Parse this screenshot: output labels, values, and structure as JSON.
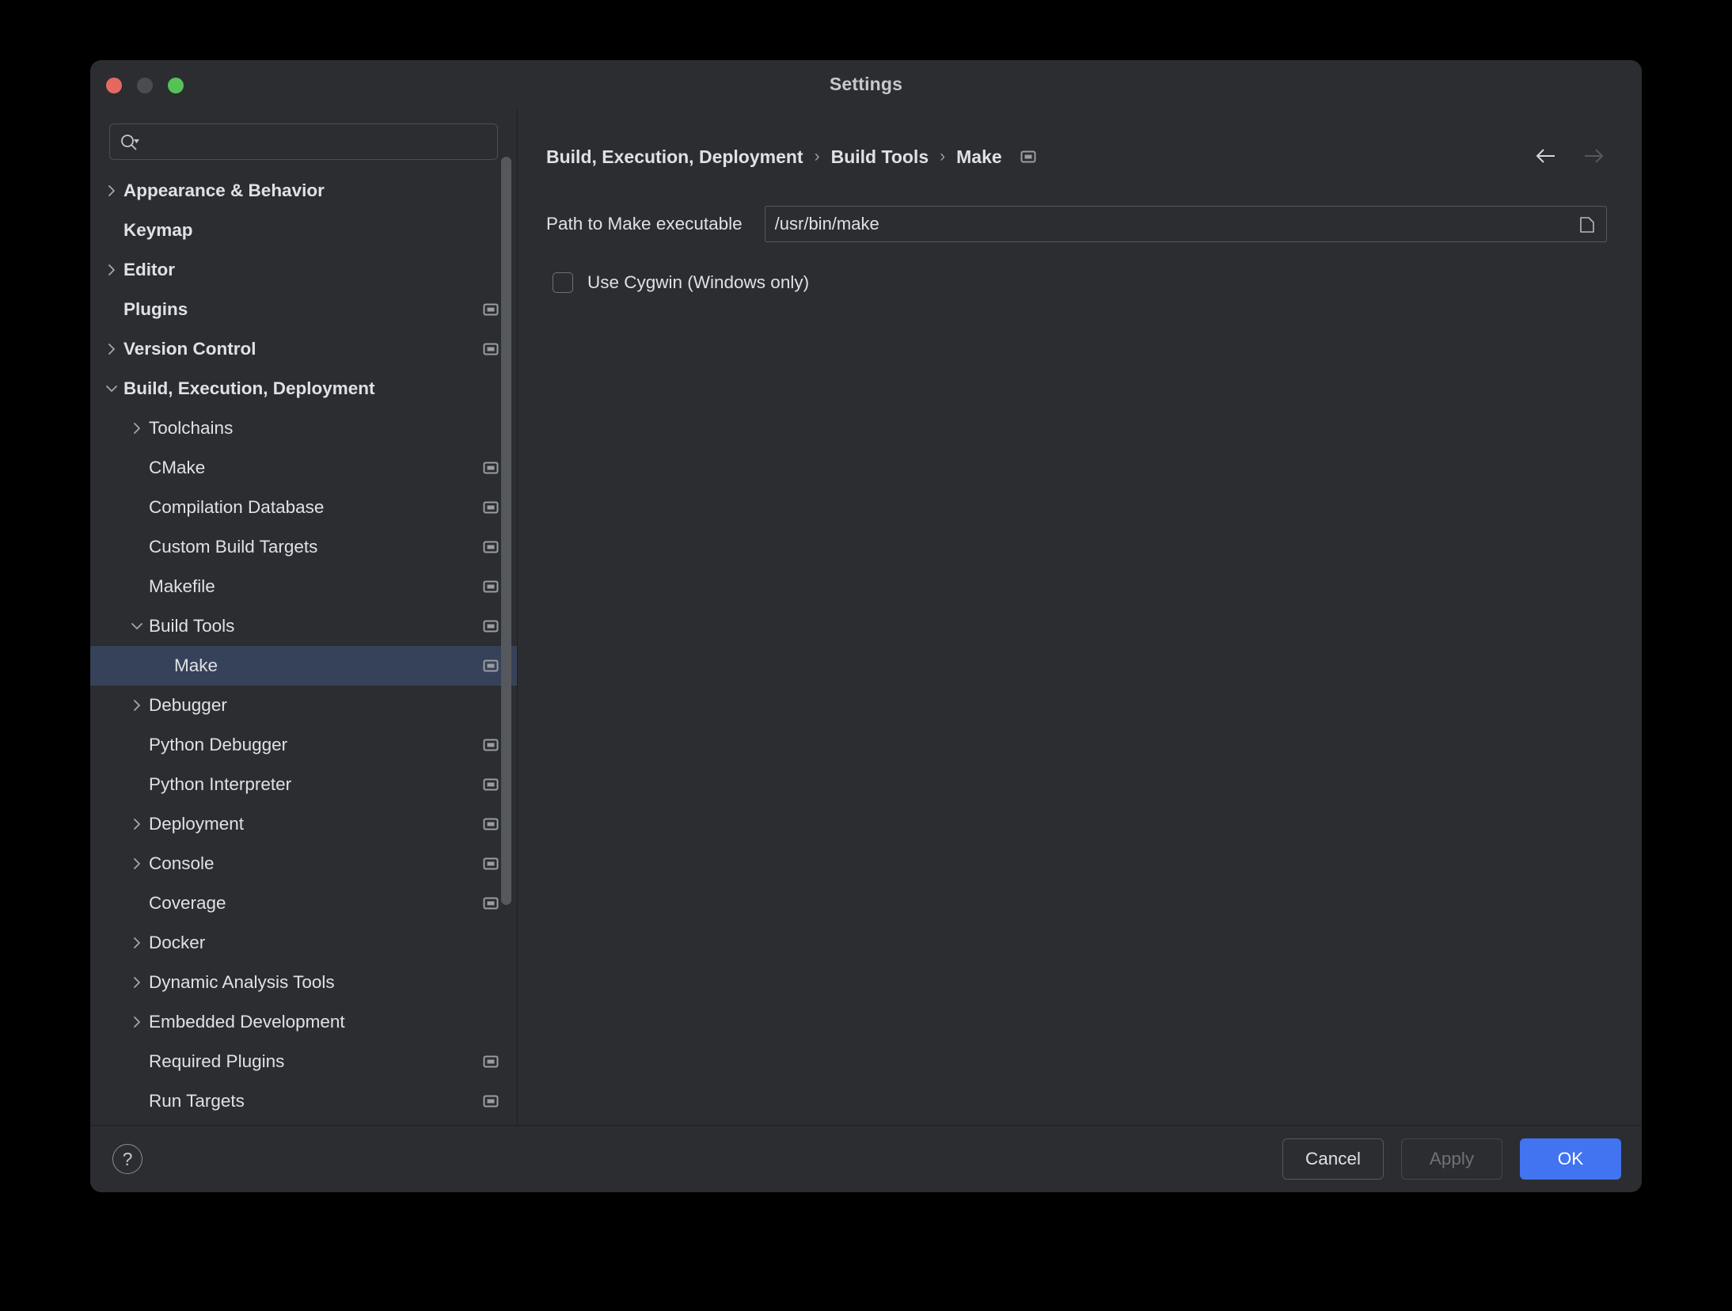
{
  "window": {
    "title": "Settings",
    "traffic_lights": [
      "close-red",
      "minimize-amber",
      "zoom-green"
    ],
    "accent_color": "#4274f1",
    "selection_color": "#364259",
    "background_color": "#2b2d30"
  },
  "search": {
    "value": "",
    "placeholder": "",
    "icon": "search-icon"
  },
  "sidebar": {
    "items": [
      {
        "label": "Appearance & Behavior",
        "level": 0,
        "chevron": "right",
        "badge": false,
        "selected": false
      },
      {
        "label": "Keymap",
        "level": 0,
        "chevron": "none",
        "badge": false,
        "selected": false
      },
      {
        "label": "Editor",
        "level": 0,
        "chevron": "right",
        "badge": false,
        "selected": false
      },
      {
        "label": "Plugins",
        "level": 0,
        "chevron": "none",
        "badge": true,
        "selected": false
      },
      {
        "label": "Version Control",
        "level": 0,
        "chevron": "right",
        "badge": true,
        "selected": false
      },
      {
        "label": "Build, Execution, Deployment",
        "level": 0,
        "chevron": "down",
        "badge": false,
        "selected": false
      },
      {
        "label": "Toolchains",
        "level": 1,
        "chevron": "right",
        "badge": false,
        "selected": false
      },
      {
        "label": "CMake",
        "level": 1,
        "chevron": "none",
        "badge": true,
        "selected": false
      },
      {
        "label": "Compilation Database",
        "level": 1,
        "chevron": "none",
        "badge": true,
        "selected": false
      },
      {
        "label": "Custom Build Targets",
        "level": 1,
        "chevron": "none",
        "badge": true,
        "selected": false
      },
      {
        "label": "Makefile",
        "level": 1,
        "chevron": "none",
        "badge": true,
        "selected": false
      },
      {
        "label": "Build Tools",
        "level": 1,
        "chevron": "down",
        "badge": true,
        "selected": false
      },
      {
        "label": "Make",
        "level": 2,
        "chevron": "none",
        "badge": true,
        "selected": true
      },
      {
        "label": "Debugger",
        "level": 1,
        "chevron": "right",
        "badge": false,
        "selected": false
      },
      {
        "label": "Python Debugger",
        "level": 1,
        "chevron": "none",
        "badge": true,
        "selected": false
      },
      {
        "label": "Python Interpreter",
        "level": 1,
        "chevron": "none",
        "badge": true,
        "selected": false
      },
      {
        "label": "Deployment",
        "level": 1,
        "chevron": "right",
        "badge": true,
        "selected": false
      },
      {
        "label": "Console",
        "level": 1,
        "chevron": "right",
        "badge": true,
        "selected": false
      },
      {
        "label": "Coverage",
        "level": 1,
        "chevron": "none",
        "badge": true,
        "selected": false
      },
      {
        "label": "Docker",
        "level": 1,
        "chevron": "right",
        "badge": false,
        "selected": false
      },
      {
        "label": "Dynamic Analysis Tools",
        "level": 1,
        "chevron": "right",
        "badge": false,
        "selected": false
      },
      {
        "label": "Embedded Development",
        "level": 1,
        "chevron": "right",
        "badge": false,
        "selected": false
      },
      {
        "label": "Required Plugins",
        "level": 1,
        "chevron": "none",
        "badge": true,
        "selected": false
      },
      {
        "label": "Run Targets",
        "level": 1,
        "chevron": "none",
        "badge": true,
        "selected": false
      }
    ]
  },
  "main": {
    "breadcrumb": {
      "parts": [
        "Build, Execution, Deployment",
        "Build Tools",
        "Make"
      ],
      "separator": "›",
      "badge": true
    },
    "nav": {
      "back": "←",
      "forward": "→",
      "back_enabled": true,
      "forward_enabled": false
    },
    "path_field": {
      "label": "Path to Make executable",
      "value": "/usr/bin/make",
      "placeholder": "",
      "browse_icon": "folder-icon"
    },
    "cygwin_checkbox": {
      "label": "Use Cygwin (Windows only)",
      "checked": false
    }
  },
  "footer": {
    "help_label": "?",
    "cancel_label": "Cancel",
    "apply_label": "Apply",
    "apply_enabled": false,
    "ok_label": "OK"
  }
}
